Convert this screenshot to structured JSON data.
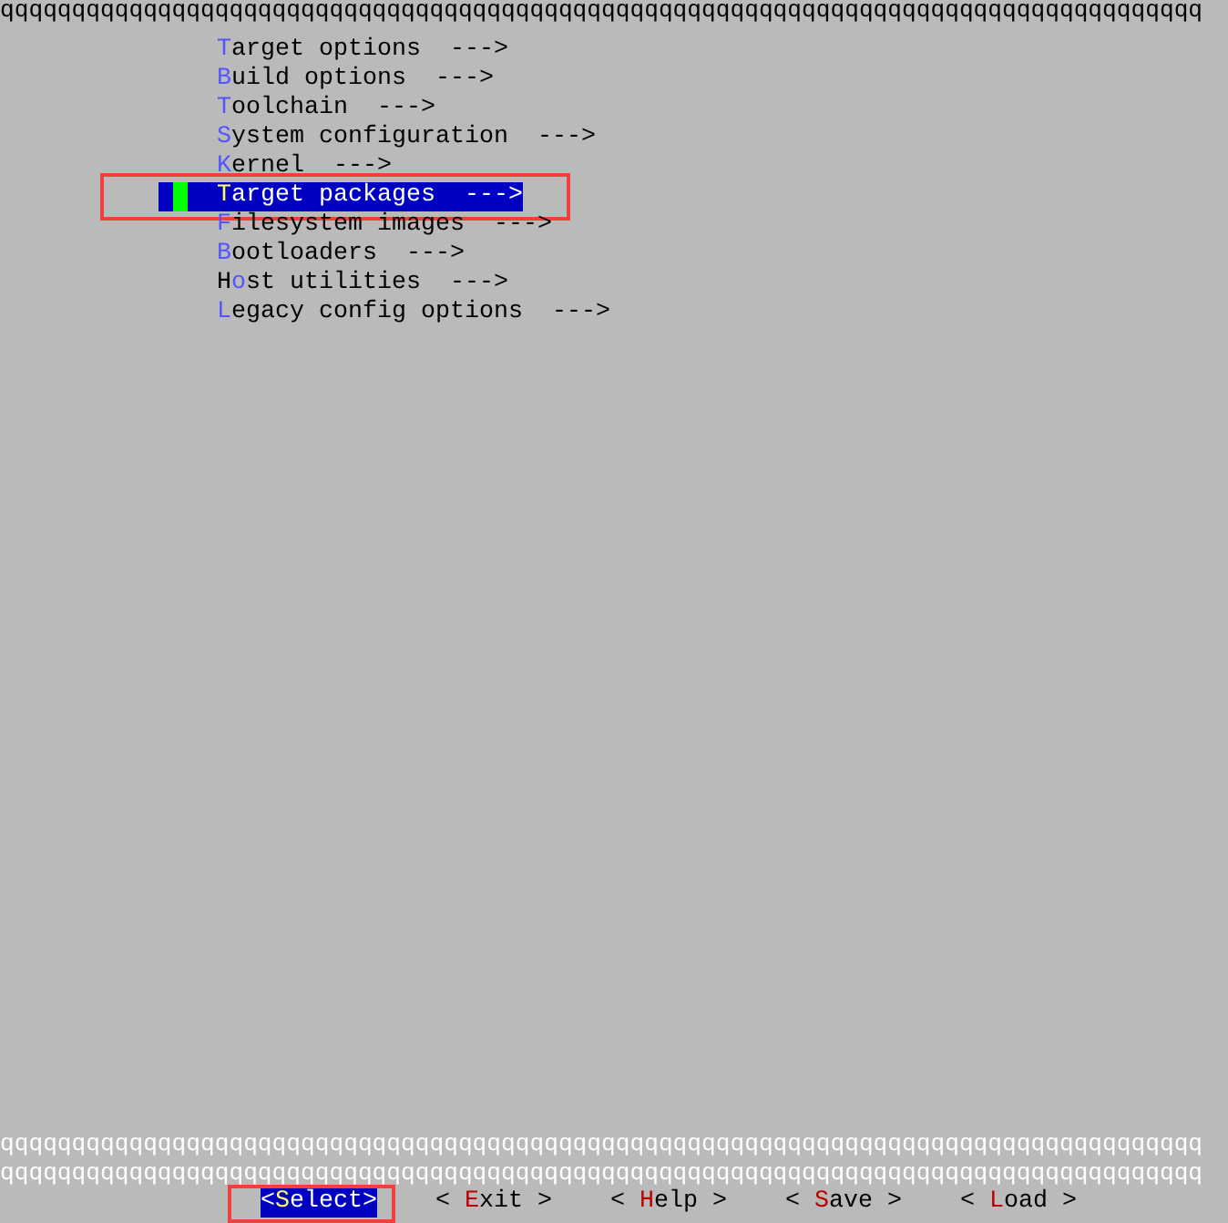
{
  "top_border": "qqqqqqqqqqqqqqqqqqqqqqqqqqqqqqqqqqqqqqqqqqqqqqqqqqqqqqqqqqqqqqqqqqqqqqqqqqqqqqqqqqqq",
  "menu_items": [
    {
      "key": "T",
      "after": "arget options  --->",
      "selected": false
    },
    {
      "key": "B",
      "after": "uild options  --->",
      "selected": false
    },
    {
      "key": "T",
      "after": "oolchain  --->",
      "selected": false
    },
    {
      "key": "S",
      "after": "ystem configuration  --->",
      "selected": false
    },
    {
      "key": "K",
      "after": "ernel  --->",
      "selected": false
    },
    {
      "key": "T",
      "after": "arget packages  --->",
      "selected": true
    },
    {
      "key": "F",
      "after": "ilesystem images  --->",
      "selected": false
    },
    {
      "key": "B",
      "after": "ootloaders  --->",
      "selected": false
    },
    {
      "before": "H",
      "key": "o",
      "after": "st utilities  --->",
      "selected": false
    },
    {
      "key": "L",
      "after": "egacy config options  --->",
      "selected": false
    }
  ],
  "bottom_borders": [
    "qqqqqqqqqqqqqqqqqqqqqqqqqqqqqqqqqqqqqqqqqqqqqqqqqqqqqqqqqqqqqqqqqqqqqqqqqqqqqqqqqqqq",
    "qqqqqqqqqqqqqqqqqqqqqqqqqqqqqqqqqqqqqqqqqqqqqqqqqqqqqqqqqqqqqqqqqqqqqqqqqqqqqqqqqqqq"
  ],
  "buttons": [
    {
      "before": "<",
      "key": "S",
      "after": "elect>",
      "selected": true
    },
    {
      "before": "< ",
      "key": "E",
      "after": "xit >",
      "selected": false
    },
    {
      "before": "< ",
      "key": "H",
      "after": "elp >",
      "selected": false
    },
    {
      "before": "< ",
      "key": "S",
      "after": "ave >",
      "selected": false
    },
    {
      "before": "< ",
      "key": "L",
      "after": "oad >",
      "selected": false
    }
  ]
}
